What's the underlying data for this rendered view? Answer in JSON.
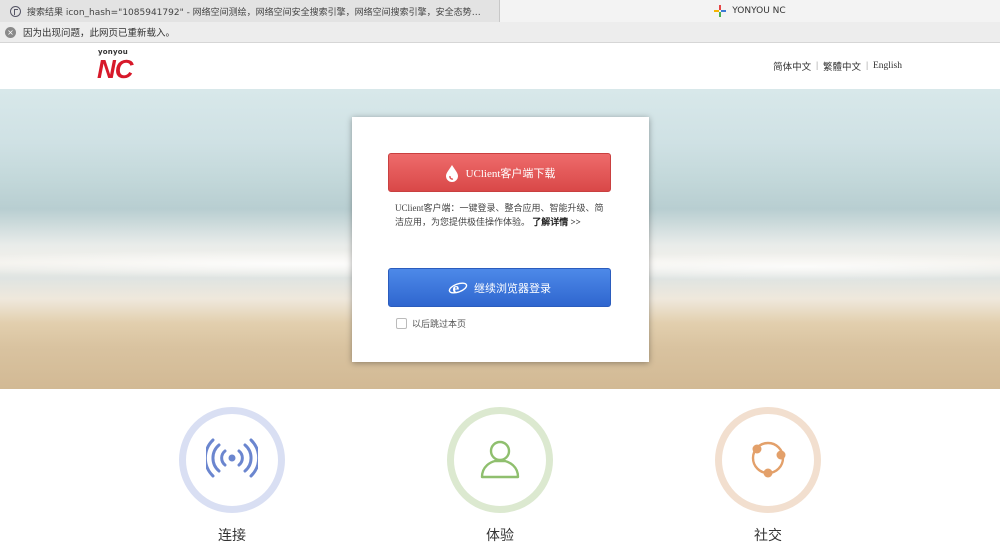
{
  "browser": {
    "tab_inactive_title": "搜索结果 icon_hash=\"1085941792\" - 网络空间测绘，网络空间安全搜索引擎，网络空间搜索引擎，安全态势感知 - FOF...",
    "tab_active_title": "YONYOU NC",
    "notice_text": "因为出现问题，此网页已重新载入。"
  },
  "header": {
    "logo_small": "yonyou",
    "logo_big": "NC",
    "languages": [
      "简体中文",
      "繁體中文",
      "English"
    ],
    "logo_color": "#d7192a"
  },
  "card": {
    "download_label": "UClient客户端下载",
    "description": "UClient客户端：一键登录、整合应用、智能升级、简洁应用，为您提供极佳操作体验。",
    "details_link": "了解详情 >>",
    "browser_login_label": "继续浏览器登录",
    "skip_label": "以后跳过本页",
    "skip_checked": false,
    "download_color": "#e05555",
    "browser_color": "#3b74db"
  },
  "features": [
    {
      "label": "连接",
      "icon": "signal-icon"
    },
    {
      "label": "体验",
      "icon": "user-icon"
    },
    {
      "label": "社交",
      "icon": "share-icon"
    }
  ]
}
